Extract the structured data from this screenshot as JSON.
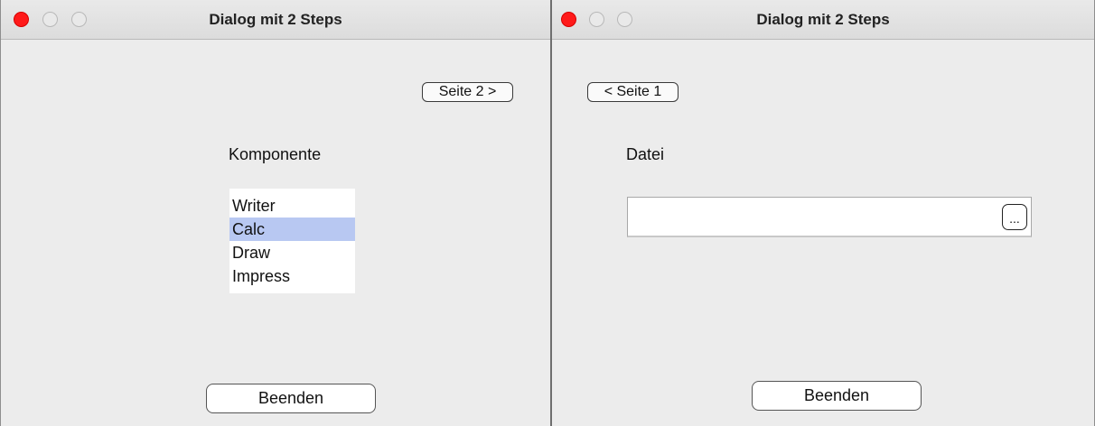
{
  "window_left": {
    "title": "Dialog mit 2 Steps",
    "next_button_label": "Seite 2 >",
    "list_label": "Komponente",
    "list_items": [
      "Writer",
      "Calc",
      "Draw",
      "Impress"
    ],
    "selected_item": "Calc",
    "close_button_label": "Beenden"
  },
  "window_right": {
    "title": "Dialog mit 2 Steps",
    "back_button_label": "< Seite 1",
    "file_label": "Datei",
    "file_value": "",
    "browse_button_label": "...",
    "close_button_label": "Beenden"
  },
  "colors": {
    "close_light": "#ff1a1a",
    "selection": "#b8c8f2"
  }
}
